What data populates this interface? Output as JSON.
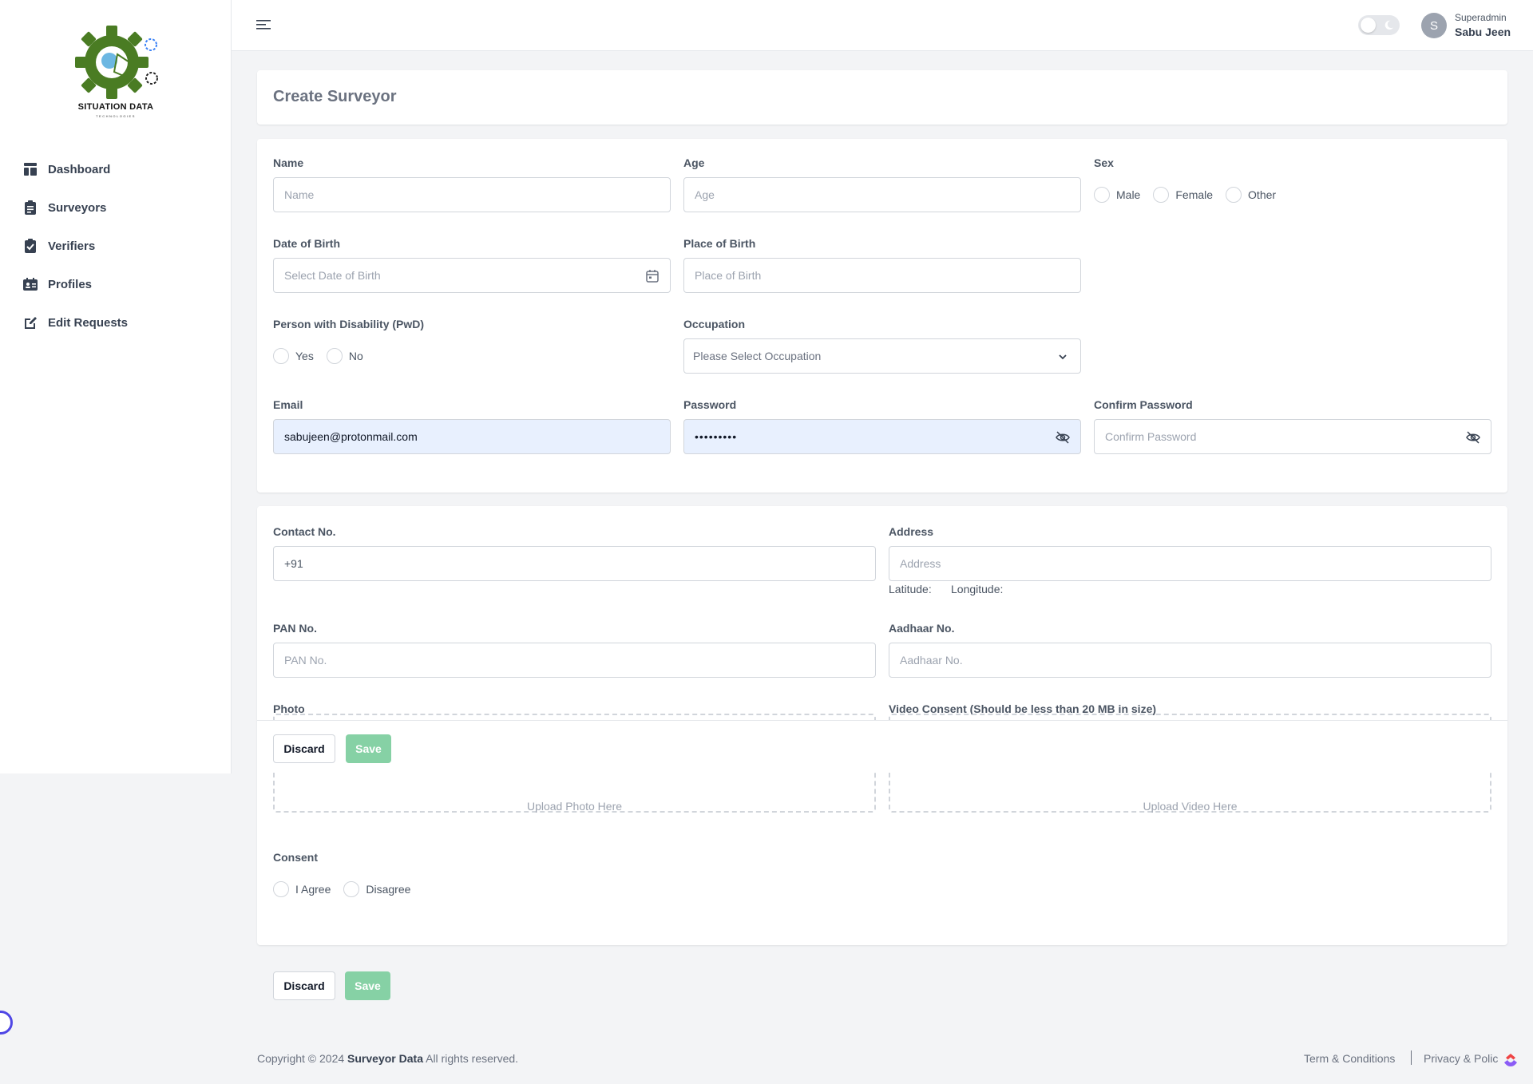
{
  "brand": {
    "name": "SITUATION DATA",
    "tagline": "TECHNOLOGIES"
  },
  "sidebar": {
    "items": [
      {
        "label": "Dashboard",
        "icon": "dashboard-icon"
      },
      {
        "label": "Surveyors",
        "icon": "clipboard-list-icon"
      },
      {
        "label": "Verifiers",
        "icon": "clipboard-check-icon"
      },
      {
        "label": "Profiles",
        "icon": "id-card-icon"
      },
      {
        "label": "Edit Requests",
        "icon": "edit-icon"
      }
    ]
  },
  "header": {
    "role": "Superadmin",
    "user_name": "Sabu Jeen",
    "avatar_initial": "S"
  },
  "page": {
    "title": "Create Surveyor"
  },
  "form": {
    "name": {
      "label": "Name",
      "placeholder": "Name"
    },
    "age": {
      "label": "Age",
      "placeholder": "Age"
    },
    "sex": {
      "label": "Sex",
      "options": [
        "Male",
        "Female",
        "Other"
      ]
    },
    "dob": {
      "label": "Date of Birth",
      "placeholder": "Select Date of Birth"
    },
    "pob": {
      "label": "Place of Birth",
      "placeholder": "Place of Birth"
    },
    "pwd": {
      "label": "Person with Disability (PwD)",
      "options": [
        "Yes",
        "No"
      ]
    },
    "occupation": {
      "label": "Occupation",
      "selected": "Please Select Occupation"
    },
    "email": {
      "label": "Email",
      "value": "sabujeen@protonmail.com"
    },
    "password": {
      "label": "Password",
      "value": "•••••••••"
    },
    "confirm_password": {
      "label": "Confirm Password",
      "placeholder": "Confirm Password"
    },
    "contact": {
      "label": "Contact No.",
      "value": "+91"
    },
    "address": {
      "label": "Address",
      "placeholder": "Address",
      "latitude_label": "Latitude:",
      "longitude_label": "Longitude:"
    },
    "pan": {
      "label": "PAN No.",
      "placeholder": "PAN No."
    },
    "aadhaar": {
      "label": "Aadhaar No.",
      "placeholder": "Aadhaar No."
    },
    "photo": {
      "label": "Photo",
      "dropzone": "Upload Photo Here"
    },
    "video": {
      "label": "Video Consent (Should be less than 20 MB in size)",
      "dropzone": "Upload Video Here"
    },
    "consent": {
      "label": "Consent",
      "options": [
        "I Agree",
        "Disagree"
      ]
    }
  },
  "actions": {
    "discard": "Discard",
    "save": "Save"
  },
  "footer": {
    "copyright_prefix": "Copyright © 2024",
    "company": "Surveyor Data",
    "copyright_suffix": "All rights reserved.",
    "terms": "Term & Conditions",
    "privacy": "Privacy & Polic"
  },
  "colors": {
    "save_button": "#86d1a5",
    "autofill_background": "#e8f0fe",
    "logo_green": "#4a7c23"
  }
}
